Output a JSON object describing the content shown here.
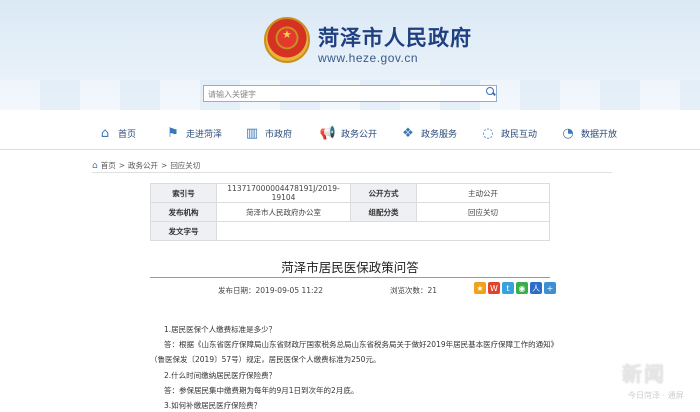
{
  "header": {
    "site_name": "菏泽市人民政府",
    "site_url": "www.heze.gov.cn",
    "search_placeholder": "请输入关键字"
  },
  "nav": [
    {
      "label": "首页",
      "icon": "home-icon"
    },
    {
      "label": "走进菏泽",
      "icon": "flag-icon"
    },
    {
      "label": "市政府",
      "icon": "building-icon"
    },
    {
      "label": "政务公开",
      "icon": "megaphone-icon"
    },
    {
      "label": "政务服务",
      "icon": "handshake-icon"
    },
    {
      "label": "政民互动",
      "icon": "chat-icon"
    },
    {
      "label": "数据开放",
      "icon": "dashboard-icon"
    }
  ],
  "breadcrumb": [
    "首页",
    "政务公开",
    "回应关切"
  ],
  "meta": {
    "row1": {
      "k1": "索引号",
      "v1": "113717000004478191J/2019-19104",
      "k2": "公开方式",
      "v2": "主动公开"
    },
    "row2": {
      "k1": "发布机构",
      "v1": "菏泽市人民政府办公室",
      "k2": "组配分类",
      "v2": "回应关切"
    },
    "row3": {
      "k1": "发文字号",
      "v1": ""
    }
  },
  "article": {
    "title": "菏泽市居民医保政策问答",
    "date_label": "发布日期：2019-09-05 11:22",
    "views_label": "浏览次数：21",
    "paragraphs": [
      "1.居民医保个人缴费标准是多少？",
      "答：根据《山东省医疗保障局山东省财政厅国家税务总局山东省税务局关于做好2019年居民基本医疗保障工作的通知》",
      "（鲁医保发〔2019〕57号）规定，居民医保个人缴费标准为250元。",
      "2.什么时间缴纳居民医疗保险费？",
      "答：参保居民集中缴费期为每年的9月1日到次年的2月底。",
      "3.如何补缴居民医疗保险费？"
    ]
  },
  "watermark": {
    "main": "新闻",
    "sub": "今日菏泽 · 通屏"
  },
  "colors": {
    "brand": "#1f3f80",
    "nav_icon": "#3a78b8"
  }
}
